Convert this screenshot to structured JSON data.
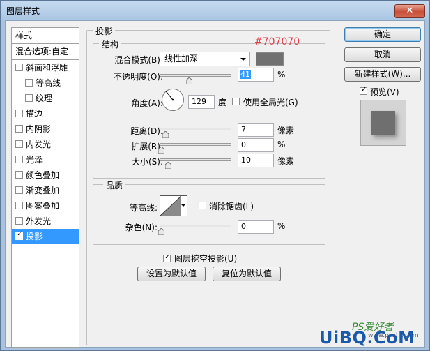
{
  "window": {
    "title": "图层样式",
    "close_glyph": "✕"
  },
  "left_list": {
    "header": "样式",
    "blend_options": "混合选项:自定",
    "items": [
      {
        "label": "斜面和浮雕",
        "checked": false
      },
      {
        "label": "等高线",
        "checked": false,
        "indent": true
      },
      {
        "label": "纹理",
        "checked": false,
        "indent": true
      },
      {
        "label": "描边",
        "checked": false
      },
      {
        "label": "内阴影",
        "checked": false
      },
      {
        "label": "内发光",
        "checked": false
      },
      {
        "label": "光泽",
        "checked": false
      },
      {
        "label": "颜色叠加",
        "checked": false
      },
      {
        "label": "渐变叠加",
        "checked": false
      },
      {
        "label": "图案叠加",
        "checked": false
      },
      {
        "label": "外发光",
        "checked": false
      },
      {
        "label": "投影",
        "checked": true,
        "selected": true
      }
    ],
    "check_glyph": "✓"
  },
  "panel": {
    "title": "投影",
    "structure": {
      "title": "结构",
      "blend_mode_label": "混合模式(B):",
      "blend_mode_value": "线性加深",
      "shadow_color": "#707070",
      "opacity_label": "不透明度(O):",
      "opacity_value": "41",
      "opacity_unit": "%",
      "opacity_level": 41,
      "angle_label": "角度(A):",
      "angle_value": "129",
      "angle_unit": "度",
      "global_light_label": "使用全局光(G)",
      "global_light_checked": false,
      "distance_label": "距离(D):",
      "distance_value": "7",
      "distance_unit": "像素",
      "spread_label": "扩展(R):",
      "spread_value": "0",
      "spread_unit": "%",
      "size_label": "大小(S):",
      "size_value": "10",
      "size_unit": "像素"
    },
    "quality": {
      "title": "品质",
      "contour_label": "等高线:",
      "antialias_label": "消除锯齿(L)",
      "antialias_checked": false,
      "noise_label": "杂色(N):",
      "noise_value": "0",
      "noise_unit": "%"
    },
    "knockout_label": "图层挖空投影(U)",
    "knockout_checked": true,
    "make_default_button": "设置为默认值",
    "reset_default_button": "复位为默认值"
  },
  "buttons": {
    "ok": "确定",
    "cancel": "取消",
    "new_style": "新建样式(W)...",
    "preview_label": "预览(V)",
    "preview_checked": true
  },
  "annotation": {
    "text": "#707070",
    "color": "#e0404a"
  },
  "watermark": {
    "site": "UiBQ.CoM",
    "logo_text": "PS爱好者",
    "url": "www.psahz.com"
  }
}
